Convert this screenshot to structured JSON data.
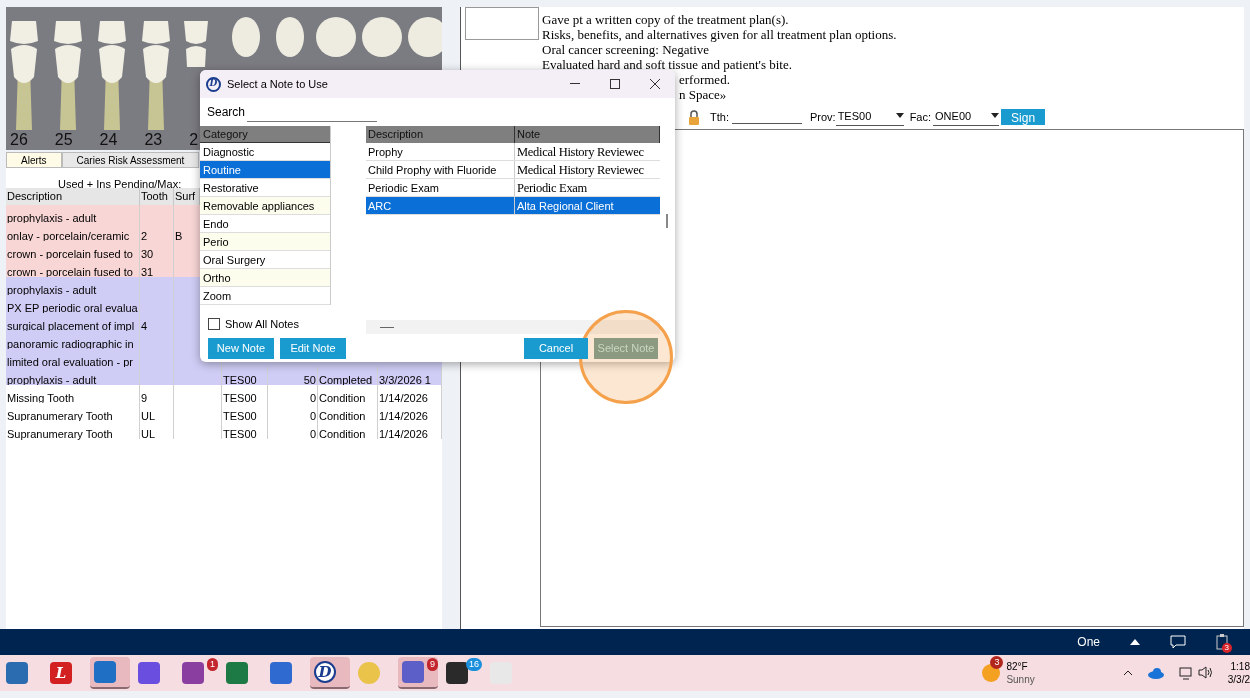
{
  "tooth_chart": {
    "numbers": [
      "26",
      "25",
      "24",
      "23",
      "2"
    ]
  },
  "tabs": [
    {
      "label": "Alerts",
      "selected": true
    },
    {
      "label": "Caries Risk Assessment",
      "selected": false
    }
  ],
  "benefits_summary": "Used + Ins Pending/Max:",
  "procedures": {
    "columns": [
      "Description",
      "Tooth",
      "Surf"
    ],
    "rows": [
      {
        "color": "#f9d6d6",
        "cells": [
          "prophylaxis - adult",
          "",
          ""
        ]
      },
      {
        "color": "#f9d6d6",
        "cells": [
          "onlay - porcelain/ceramic",
          "2",
          "B"
        ]
      },
      {
        "color": "#f9d6d6",
        "cells": [
          "crown - porcelain fused to",
          "30",
          ""
        ]
      },
      {
        "color": "#f9d6d6",
        "cells": [
          "crown - porcelain fused to",
          "31",
          ""
        ]
      },
      {
        "color": "#cfcdf5",
        "cells": [
          "prophylaxis - adult",
          "",
          ""
        ]
      },
      {
        "color": "#cfcdf5",
        "cells": [
          "PX EP periodic oral evalua",
          "",
          ""
        ]
      },
      {
        "color": "#cfcdf5",
        "cells": [
          "surgical placement of impl",
          "4",
          ""
        ]
      },
      {
        "color": "#cfcdf5",
        "cells": [
          "panoramic radiographic in",
          "",
          ""
        ]
      },
      {
        "color": "#cfcdf5",
        "cells": [
          "limited oral evaluation - pr",
          "",
          ""
        ]
      },
      {
        "color": "#cfcdf5",
        "cells": [
          "prophylaxis - adult",
          "",
          "",
          "TES00",
          "50",
          "Completed",
          "3/3/2026 1"
        ]
      },
      {
        "color": "#ffffff",
        "cells": [
          "Missing Tooth",
          "9",
          "",
          "TES00",
          "0",
          "Condition",
          "1/14/2026"
        ]
      },
      {
        "color": "#ffffff",
        "cells": [
          "Supranumerary Tooth",
          "UL",
          "",
          "TES00",
          "0",
          "Condition",
          "1/14/2026"
        ]
      },
      {
        "color": "#ffffff",
        "cells": [
          "Supranumerary Tooth",
          "UL",
          "",
          "TES00",
          "0",
          "Condition",
          "1/14/2026"
        ]
      }
    ]
  },
  "progress_notes": {
    "lines": [
      {
        "kind": "full",
        "text": "Gave pt a written copy of the treatment plan(s)."
      },
      {
        "kind": "full",
        "text": "Risks, benefits, and alternatives given for all treatment plan options."
      },
      {
        "kind": "full",
        "text": "Oral cancer screening: Negative"
      },
      {
        "kind": "full",
        "text": "Evaluated hard and soft tissue and patient's bite."
      },
      {
        "kind": "partial",
        "text": "erformed."
      },
      {
        "kind": "partial",
        "text": "n Space»"
      }
    ]
  },
  "note_toolbar": {
    "tooth_label": "Tth:",
    "provider_label": "Prov:",
    "provider": "TES00",
    "facility_label": "Fac:",
    "facility": "ONE00",
    "sign_button": "Sign"
  },
  "dialog": {
    "logo": "D",
    "title": "Select a Note to Use",
    "search_label": "Search",
    "category_header": "Category",
    "categories": [
      {
        "label": "Diagnostic",
        "selected": false
      },
      {
        "label": "Routine",
        "selected": true
      },
      {
        "label": "Restorative",
        "selected": false
      },
      {
        "label": "Removable appliances",
        "selected": false
      },
      {
        "label": "Endo",
        "selected": false
      },
      {
        "label": "Perio",
        "selected": false
      },
      {
        "label": "Oral Surgery",
        "selected": false
      },
      {
        "label": "Ortho",
        "selected": false
      },
      {
        "label": "Zoom",
        "selected": false
      }
    ],
    "note_columns": [
      "Description",
      "Note"
    ],
    "notes": [
      {
        "description": "Prophy",
        "note": "Medical History Reviewec",
        "selected": false
      },
      {
        "description": "Child Prophy with Fluoride",
        "note": "Medical History Reviewec",
        "selected": false
      },
      {
        "description": "Periodic Exam",
        "note": "Periodic Exam",
        "selected": false
      },
      {
        "description": "ARC",
        "note": "Alta Regional Client",
        "selected": true
      }
    ],
    "show_all_notes": {
      "label": "Show All Notes",
      "checked": false
    },
    "left_buttons": [
      {
        "label": "New Note",
        "disabled": false
      },
      {
        "label": "Edit Note",
        "disabled": false
      }
    ],
    "right_buttons": [
      {
        "label": "Cancel",
        "disabled": false
      },
      {
        "label": "Select Note",
        "disabled": true
      }
    ],
    "highlight": true
  },
  "status_bar": {
    "location": "One",
    "notification_badge": "3"
  },
  "taskbar": {
    "apps": [
      {
        "kind": "files",
        "active": false
      },
      {
        "kind": "letter",
        "label": "L",
        "active": false
      },
      {
        "kind": "mail",
        "active": true
      },
      {
        "kind": "stripes",
        "active": false
      },
      {
        "kind": "splash",
        "badge": "1",
        "active": false
      },
      {
        "kind": "sheet",
        "active": false
      },
      {
        "kind": "doc",
        "active": false
      },
      {
        "kind": "logo",
        "label": "D",
        "active": true
      },
      {
        "kind": "mascot",
        "active": false
      },
      {
        "kind": "team",
        "badge": "9",
        "active": true
      },
      {
        "kind": "phone",
        "badge": "16",
        "active": false
      },
      {
        "kind": "snip",
        "active": false
      }
    ],
    "weather": {
      "temperature": "82°F",
      "condition": "Sunny",
      "badge": "3"
    },
    "clock": {
      "time": "1:18",
      "date": "3/3/2"
    }
  }
}
